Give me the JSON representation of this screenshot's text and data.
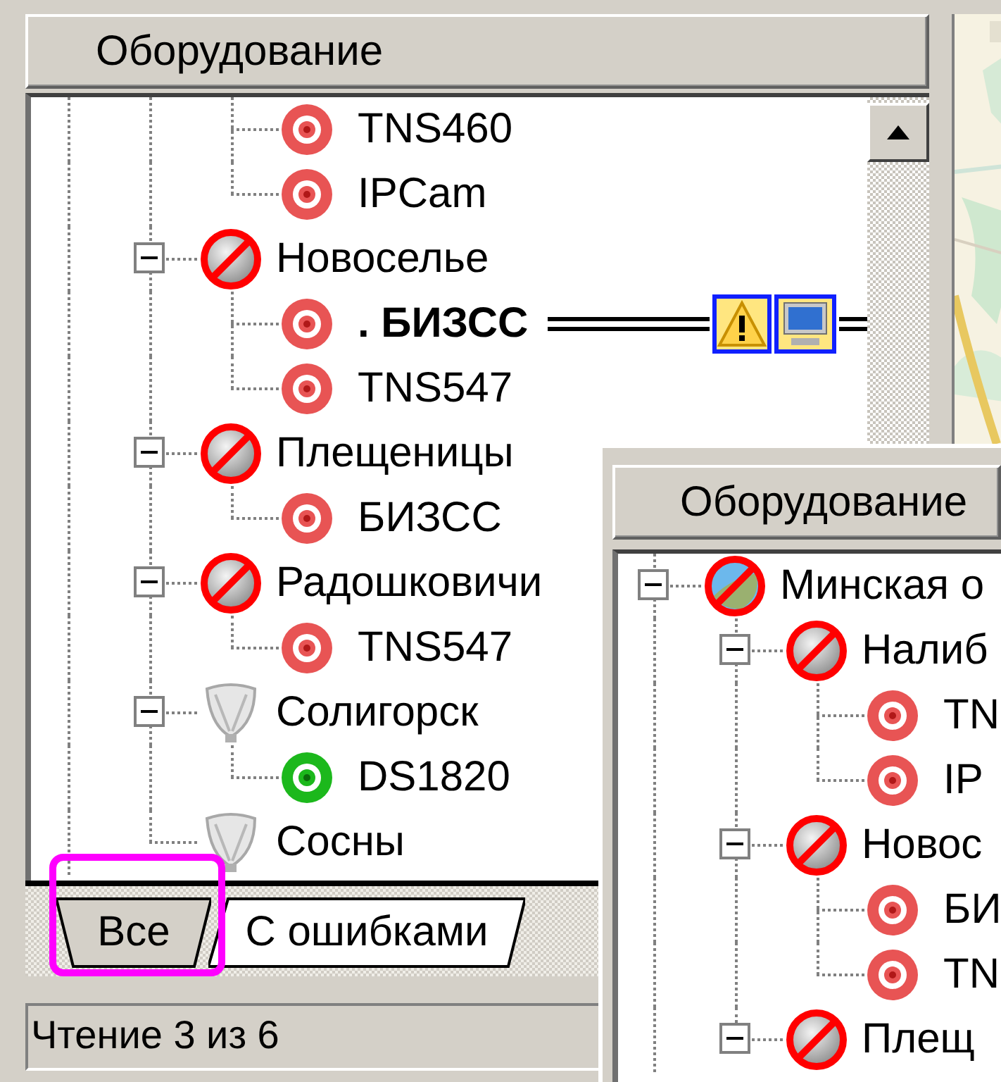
{
  "equipment_panel": {
    "header": "Оборудование",
    "tree": [
      {
        "children": [
          {
            "children": [
              {
                "label": "TNS460",
                "kind": "fault",
                "selected": false
              },
              {
                "label": "IPCam",
                "kind": "fault",
                "selected": false
              }
            ]
          },
          {
            "label": "Новоселье",
            "kind": "blocked",
            "expanded": true,
            "selected": false,
            "children": [
              {
                "label": ". БИЗСС",
                "kind": "fault",
                "selected": true,
                "badges": [
                  {
                    "kind": "warning"
                  },
                  {
                    "kind": "computer"
                  }
                ]
              },
              {
                "label": "TNS547",
                "kind": "fault",
                "selected": false
              }
            ]
          },
          {
            "label": "Плещеницы",
            "kind": "blocked",
            "expanded": true,
            "selected": false,
            "children": [
              {
                "label": "БИЗСС",
                "kind": "fault",
                "selected": false
              }
            ]
          },
          {
            "label": "Радошковичи",
            "kind": "blocked",
            "expanded": true,
            "selected": false,
            "children": [
              {
                "label": "TNS547",
                "kind": "fault",
                "selected": false
              }
            ]
          },
          {
            "label": "Солигорск",
            "kind": "inactive",
            "expanded": true,
            "selected": false,
            "children": [
              {
                "label": "DS1820",
                "kind": "ok",
                "selected": false
              }
            ]
          },
          {
            "label": "Сосны",
            "kind": "inactive",
            "selected": false
          }
        ]
      }
    ],
    "tabs": [
      {
        "label": "Все",
        "selected": true,
        "highlighted": true
      },
      {
        "label": "С ошибками",
        "selected": false,
        "highlighted": false
      }
    ]
  },
  "status_bar": {
    "text": "Чтение 3 из 6"
  },
  "overlay_window": {
    "header": "Оборудование",
    "tree": [
      {
        "label": "Минская о",
        "kind": "region-blocked",
        "expanded": true,
        "selected": false,
        "children": [
          {
            "label": "Налиб",
            "kind": "blocked",
            "expanded": true,
            "selected": false,
            "children": [
              {
                "label": "TN",
                "kind": "fault",
                "selected": false
              },
              {
                "label": "IP",
                "kind": "fault",
                "selected": false
              }
            ]
          },
          {
            "label": "Новос",
            "kind": "blocked",
            "expanded": true,
            "selected": false,
            "children": [
              {
                "label": "БИ",
                "kind": "fault",
                "selected": false
              },
              {
                "label": "TN",
                "kind": "fault",
                "selected": false
              }
            ]
          },
          {
            "label": "Плещ",
            "kind": "blocked",
            "expanded": true,
            "selected": false
          }
        ]
      }
    ]
  }
}
